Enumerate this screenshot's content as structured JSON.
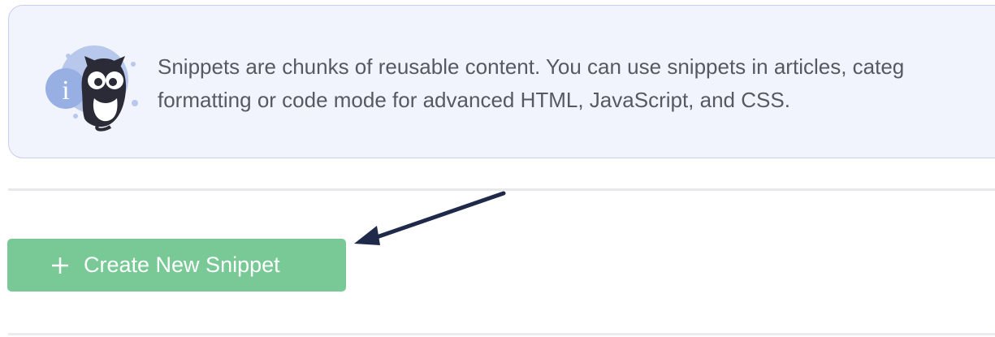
{
  "info_callout": {
    "line1": "Snippets are chunks of reusable content. You can use snippets in articles, categ",
    "line2": "formatting or code mode for advanced HTML, JavaScript, and CSS.",
    "illustration": "owl-info-icon"
  },
  "create_button": {
    "icon": "plus-icon",
    "label": "Create New Snippet"
  },
  "annotation": {
    "icon": "arrow-icon"
  },
  "colors": {
    "callout_background": "#f2f4fd",
    "callout_border": "#c9cdee",
    "text": "#555a62",
    "button": "#78c995",
    "arrow": "#1f2a4a"
  }
}
